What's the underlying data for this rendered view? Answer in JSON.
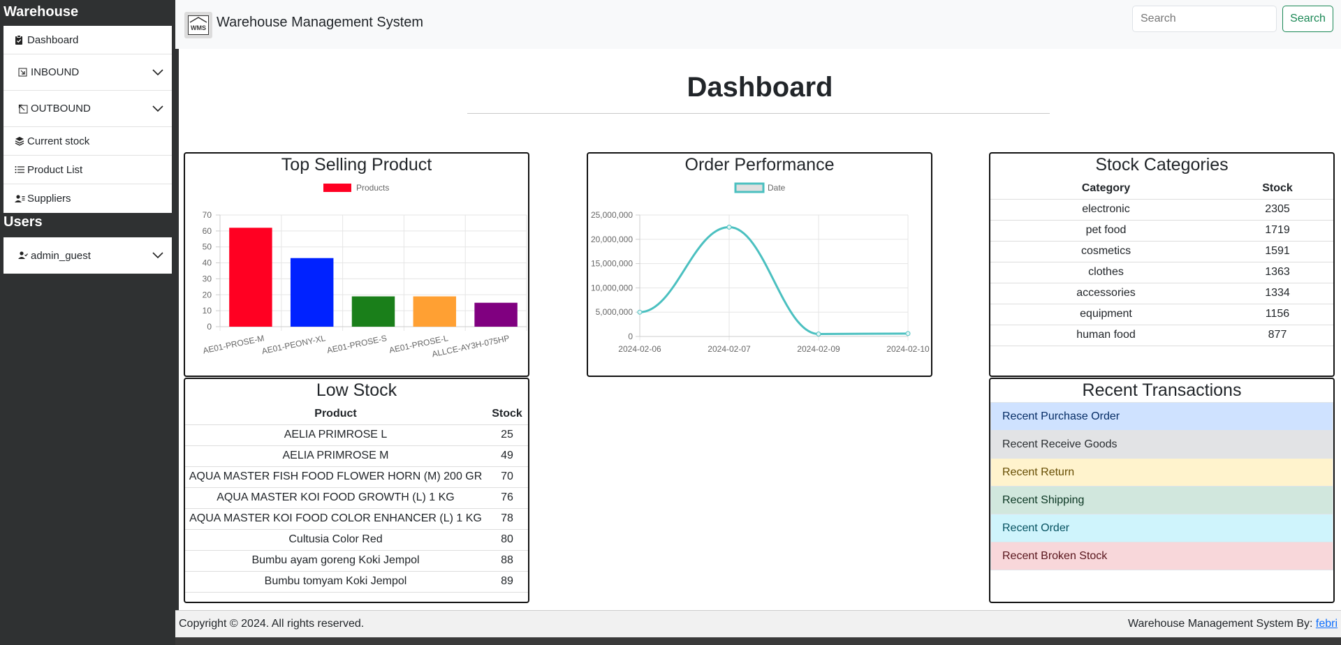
{
  "sidebar": {
    "title": "Warehouse",
    "items": [
      {
        "label": "Dashboard",
        "icon": "clipboard-icon"
      },
      {
        "label": "INBOUND",
        "icon": "inbound-icon",
        "expandable": true
      },
      {
        "label": "OUTBOUND",
        "icon": "outbound-icon",
        "expandable": true
      },
      {
        "label": "Current stock",
        "icon": "layers-icon"
      },
      {
        "label": "Product List",
        "icon": "list-icon"
      },
      {
        "label": "Suppliers",
        "icon": "users-icon"
      }
    ],
    "users_title": "Users",
    "user": {
      "label": "admin_guest",
      "icon": "user-check-icon"
    }
  },
  "header": {
    "app_title": "Warehouse Management System",
    "logo_text": "WMS",
    "search_placeholder": "Search",
    "search_button": "Search"
  },
  "page": {
    "title": "Dashboard"
  },
  "top_selling": {
    "title": "Top Selling Product"
  },
  "order_performance": {
    "title": "Order Performance"
  },
  "stock_categories": {
    "title": "Stock Categories",
    "headers": [
      "Category",
      "Stock"
    ],
    "rows": [
      [
        "electronic",
        "2305"
      ],
      [
        "pet food",
        "1719"
      ],
      [
        "cosmetics",
        "1591"
      ],
      [
        "clothes",
        "1363"
      ],
      [
        "accessories",
        "1334"
      ],
      [
        "equipment",
        "1156"
      ],
      [
        "human food",
        "877"
      ]
    ]
  },
  "low_stock": {
    "title": "Low Stock",
    "headers": [
      "Product",
      "Stock"
    ],
    "rows": [
      [
        "AELIA PRIMROSE L",
        "25"
      ],
      [
        "AELIA PRIMROSE M",
        "49"
      ],
      [
        "AQUA MASTER FISH FOOD FLOWER HORN (M) 200 GR",
        "70"
      ],
      [
        "AQUA MASTER KOI FOOD GROWTH (L) 1 KG",
        "76"
      ],
      [
        "AQUA MASTER KOI FOOD COLOR ENHANCER (L) 1 KG",
        "78"
      ],
      [
        "Cultusia Color Red",
        "80"
      ],
      [
        "Bumbu ayam goreng Koki Jempol",
        "88"
      ],
      [
        "Bumbu tomyam Koki Jempol",
        "89"
      ]
    ]
  },
  "recent_transactions": {
    "title": "Recent Transactions",
    "items": [
      {
        "label": "Recent Purchase Order",
        "bg": "#cfe2ff",
        "fg": "#052c65"
      },
      {
        "label": "Recent Receive Goods",
        "bg": "#e2e3e5",
        "fg": "#2b2f32"
      },
      {
        "label": "Recent Return",
        "bg": "#fff3cd",
        "fg": "#664d03"
      },
      {
        "label": "Recent Shipping",
        "bg": "#d1e7dd",
        "fg": "#0a3622"
      },
      {
        "label": "Recent Order",
        "bg": "#cff4fc",
        "fg": "#055160"
      },
      {
        "label": "Recent Broken Stock",
        "bg": "#f8d7da",
        "fg": "#58151c"
      }
    ]
  },
  "footer": {
    "copyright": "Copyright © 2024. All rights reserved.",
    "credit_prefix": "Warehouse Management System By: ",
    "credit_link": "febri"
  },
  "chart_data": [
    {
      "type": "bar",
      "legend": "Products",
      "categories": [
        "AE01-PROSE-M",
        "AE01-PEONY-XL",
        "AE01-PROSE-S",
        "AE01-PROSE-L",
        "ALLCE-AY3H-075HP"
      ],
      "values": [
        62,
        43,
        19,
        19,
        15
      ],
      "colors": [
        "#ff0022",
        "#0022ff",
        "#1a7f1a",
        "#ffa033",
        "#800080"
      ],
      "ylim": [
        0,
        70
      ],
      "yticks": [
        0,
        10,
        20,
        30,
        40,
        50,
        60,
        70
      ],
      "legend_position": "top",
      "grid": true
    },
    {
      "type": "line",
      "legend": "Date",
      "x": [
        "2024-02-06",
        "2024-02-07",
        "2024-02-09",
        "2024-02-10"
      ],
      "values": [
        5000000,
        22500000,
        500000,
        600000
      ],
      "color": "#4bc0c0",
      "ylim": [
        0,
        25000000
      ],
      "yticks": [
        "0",
        "5,000,000",
        "10,000,000",
        "15,000,000",
        "20,000,000",
        "25,000,000"
      ],
      "legend_position": "top",
      "grid": true
    }
  ]
}
